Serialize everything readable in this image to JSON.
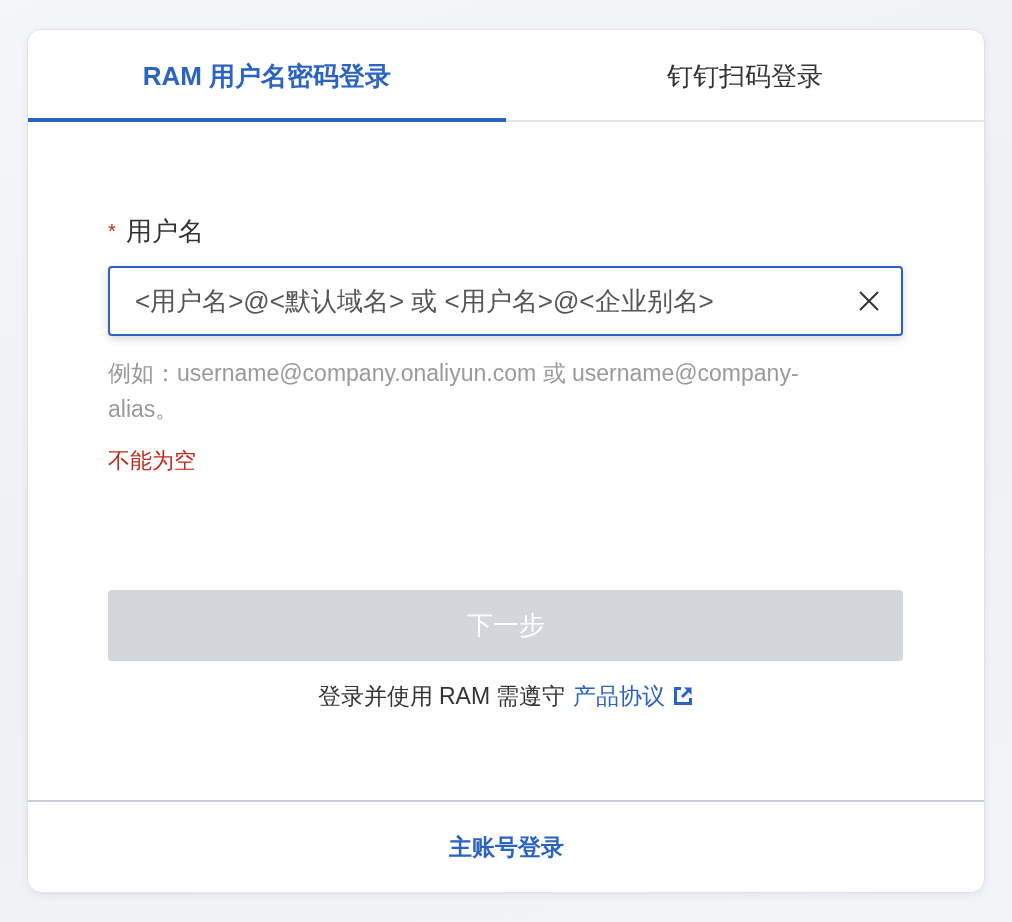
{
  "tabs": [
    {
      "label": "RAM 用户名密码登录",
      "selected": true
    },
    {
      "label": "钉钉扫码登录",
      "selected": false
    }
  ],
  "form": {
    "field": {
      "required_mark": "*",
      "label": "用户名",
      "placeholder": "<用户名>@<默认域名> 或 <用户名>@<企业别名>",
      "focused": true,
      "hint": "例如：username@company.onaliyun.com 或 username@company-alias。",
      "error": "不能为空"
    },
    "submit": {
      "label": "下一步",
      "disabled": true
    },
    "agreement": {
      "text": "登录并使用 RAM 需遵守",
      "link": "产品协议"
    }
  },
  "footer": {
    "link": "主账号登录"
  }
}
